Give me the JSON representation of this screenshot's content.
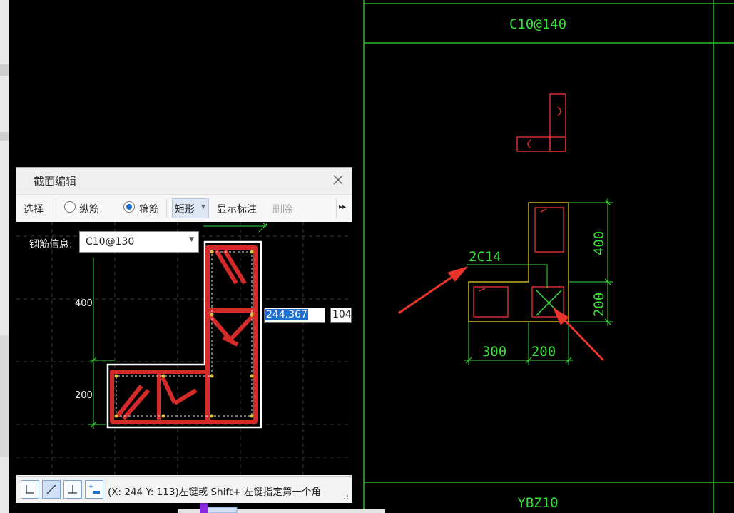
{
  "drawing": {
    "top_label": "C10@140",
    "leader_label": "2C14",
    "dim_400": "400",
    "dim_200_v": "200",
    "dim_300": "300",
    "dim_200_h": "200",
    "bottom_label": "YBZ10"
  },
  "dialog": {
    "title": "截面编辑",
    "toolbar": {
      "select": "选择",
      "longitudinal": "纵筋",
      "stirrup": "箍筋",
      "shape": "矩形",
      "show_annotation": "显示标注",
      "delete": "删除"
    },
    "rebar_info_label": "钢筋信息:",
    "rebar_info_value": "C10@130",
    "canvas_dim_400": "400",
    "canvas_dim_200": "200",
    "input_primary": "244.367",
    "input_secondary": "104",
    "status_text": "(X: 244 Y: 113)左键或 Shift+ 左键指定第一个角"
  },
  "colors": {
    "cad_green": "#35e035",
    "rebar_red": "#d42a2a",
    "accent_blue": "#1f6fd0",
    "arrow_red": "#e8352b"
  }
}
